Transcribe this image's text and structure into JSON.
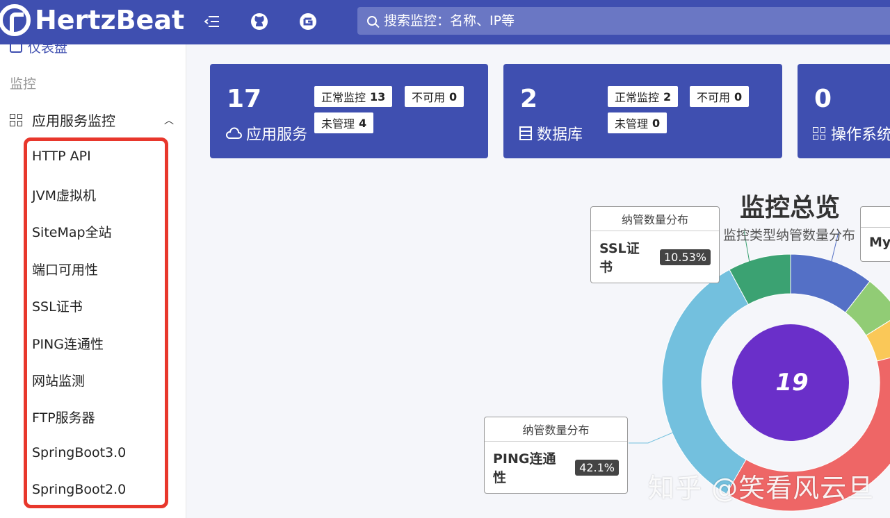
{
  "header": {
    "logo_text": "HertzBeat",
    "search_placeholder": "搜索监控：名称、IP等"
  },
  "sidebar": {
    "dashboard_label": "仪表盘",
    "group_label": "监控",
    "submenu_label": "应用服务监控",
    "items": [
      {
        "label": "HTTP API"
      },
      {
        "label": "JVM虚拟机"
      },
      {
        "label": "SiteMap全站"
      },
      {
        "label": "端口可用性"
      },
      {
        "label": "SSL证书"
      },
      {
        "label": "PING连通性"
      },
      {
        "label": "网站监测"
      },
      {
        "label": "FTP服务器"
      },
      {
        "label": "SpringBoot3.0"
      },
      {
        "label": "SpringBoot2.0"
      }
    ]
  },
  "cards": [
    {
      "count": "17",
      "label": "应用服务",
      "icon": "cloud-icon",
      "tags": [
        {
          "label": "正常监控",
          "value": "13"
        },
        {
          "label": "不可用",
          "value": "0"
        },
        {
          "label": "未管理",
          "value": "4"
        }
      ]
    },
    {
      "count": "2",
      "label": "数据库",
      "icon": "database-icon",
      "tags": [
        {
          "label": "正常监控",
          "value": "2"
        },
        {
          "label": "不可用",
          "value": "0"
        },
        {
          "label": "未管理",
          "value": "0"
        }
      ]
    },
    {
      "count": "0",
      "label": "操作系统",
      "icon": "os-grid-icon"
    }
  ],
  "chart_data": {
    "type": "pie",
    "title": "监控总览",
    "subtitle": "监控类型纳管数量分布",
    "center_value": "19",
    "slices": [
      {
        "name": "Mys",
        "color": "#5470c6"
      },
      {
        "name": "",
        "color": "#91cc75"
      },
      {
        "name": "",
        "color": "#fac858"
      },
      {
        "name": "",
        "color": "#ee6666"
      },
      {
        "name": "PING连通性",
        "percent": 42.1,
        "color": "#73c0de"
      },
      {
        "name": "SSL证书",
        "percent": 10.53,
        "color": "#3ba272"
      }
    ],
    "center_color": "#6a2fc9"
  },
  "tooltips": [
    {
      "head": "纳管数量分布",
      "name": "SSL证书",
      "percent": "10.53%"
    },
    {
      "head": "纳管数量分布",
      "name": "PING连通性",
      "percent": "42.1%"
    },
    {
      "name": "Mys"
    }
  ],
  "watermark": "知乎 @笑看风云旦"
}
